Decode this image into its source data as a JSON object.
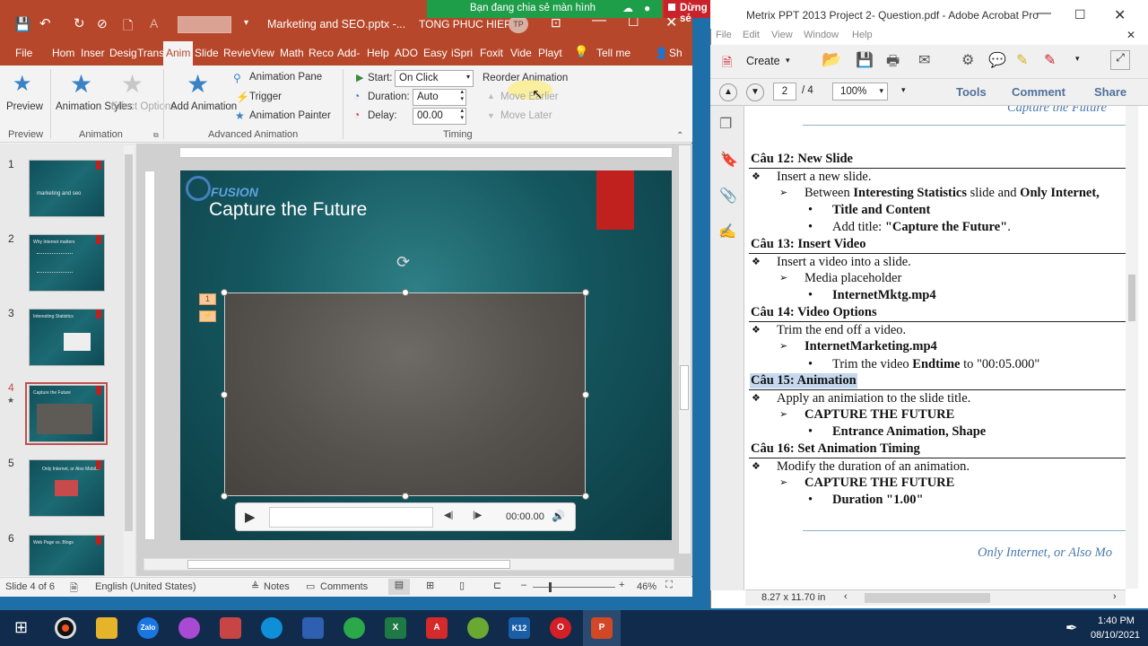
{
  "share_banner": {
    "status": "Bạn đang chia sẻ màn hình",
    "stop": "Dừng chia sẻ"
  },
  "ppt": {
    "doc_title": "Marketing and SEO.pptx -...",
    "user": "TONG PHUC HIEP",
    "user_initials": "TP",
    "tabs": [
      "File",
      "Hom",
      "Inser",
      "Desig",
      "Trans",
      "Anim",
      "Slide",
      "Revie",
      "View",
      "Math",
      "Reco",
      "Add-",
      "Help",
      "ADO",
      "Easy",
      "iSpri",
      "Foxit",
      "Vide",
      "Playt"
    ],
    "tell_me": "Tell me",
    "share": "Sh",
    "ribbon": {
      "preview": "Preview",
      "animation_styles": "Animation Styles",
      "effect_options": "Effect Options",
      "group_preview": "Preview",
      "group_animation": "Animation",
      "add_animation": "Add Animation",
      "animation_pane": "Animation Pane",
      "trigger": "Trigger",
      "animation_painter": "Animation Painter",
      "group_advanced": "Advanced Animation",
      "start_label": "Start:",
      "start_value": "On Click",
      "duration_label": "Duration:",
      "duration_value": "Auto",
      "delay_label": "Delay:",
      "delay_value": "00.00",
      "group_timing": "Timing",
      "reorder": "Reorder Animation",
      "move_earlier": "Move Earlier",
      "move_later": "Move Later"
    },
    "thumbnails": [
      {
        "num": "1",
        "text": "marketing and seo"
      },
      {
        "num": "2",
        "text": "Why Internet matters"
      },
      {
        "num": "3",
        "text": "Interesting Statistics"
      },
      {
        "num": "4",
        "text": "Capture the Future"
      },
      {
        "num": "5",
        "text": "Only Internet, or Also Mobile?"
      },
      {
        "num": "6",
        "text": "Web Page vs. Blogs"
      }
    ],
    "slide": {
      "logo": "FUSION",
      "title": "Capture the Future",
      "anim_tag_1": "1",
      "video_time": "00:00.00"
    },
    "status": {
      "slide_of": "Slide 4 of 6",
      "language": "English (United States)",
      "notes": "Notes",
      "comments": "Comments",
      "zoom": "46%"
    }
  },
  "acrobat": {
    "title": "Metrix PPT 2013 Project 2- Question.pdf - Adobe Acrobat Pro",
    "menu": [
      "File",
      "Edit",
      "View",
      "Window",
      "Help"
    ],
    "create": "Create",
    "page_current": "2",
    "page_total": "/ 4",
    "zoom": "100%",
    "tools": "Tools",
    "comment": "Comment",
    "share": "Share",
    "page_size": "8.27 x 11.70 in",
    "doc": {
      "top_cut": "Capture the Future",
      "sections": [
        {
          "head": "Câu 12:  New Slide",
          "l1": "Insert a new slide.",
          "l2_pre": "Between ",
          "l2_b1": "Interesting Statistics",
          "l2_mid": " slide and ",
          "l2_b2": "Only Internet,",
          "l3": "Title and Content",
          "l4_pre": "Add title: ",
          "l4_b": "\"Capture the Future\"",
          "l4_post": "."
        },
        {
          "head": "Câu 13:  Insert Video",
          "l1": "Insert a video into a slide.",
          "l2": "Media placeholder",
          "l3": "InternetMktg.mp4"
        },
        {
          "head": "Câu 14:  Video Options",
          "l1": "Trim the end off a video.",
          "l2": "InternetMarketing.mp4",
          "l3_pre": "Trim the video ",
          "l3_b": "Endtime",
          "l3_post": " to \"00:05.000\""
        },
        {
          "head": "Câu 15:  Animation",
          "l1": "Apply an animiation to the slide title.",
          "l2": "CAPTURE THE FUTURE",
          "l3": "Entrance Animation, Shape"
        },
        {
          "head": "Câu 16:  Set Animation Timing",
          "l1": "Modify the duration of an animation.",
          "l2": "CAPTURE THE FUTURE",
          "l3": "Duration \"1.00\""
        }
      ],
      "footer": "Only Internet, or Also Mo"
    }
  },
  "taskbar": {
    "time": "1:40 PM",
    "date": "08/10/2021"
  }
}
